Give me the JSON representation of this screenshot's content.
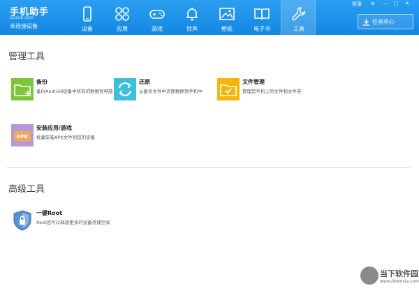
{
  "header": {
    "logo_title": "手机助手",
    "logo_url": "5Dsub.com",
    "connection_status": "未连接设备",
    "top_links": [
      "登录",
      "≡",
      "—",
      "▢",
      "✕"
    ],
    "task_center_label": "任务中心"
  },
  "nav": [
    {
      "label": "设备",
      "icon": "phone-icon"
    },
    {
      "label": "应用",
      "icon": "apps-icon"
    },
    {
      "label": "游戏",
      "icon": "gamepad-icon"
    },
    {
      "label": "铃声",
      "icon": "bell-icon"
    },
    {
      "label": "壁纸",
      "icon": "image-icon"
    },
    {
      "label": "电子书",
      "icon": "book-icon"
    },
    {
      "label": "工具",
      "icon": "wrench-icon",
      "active": true
    }
  ],
  "sections": {
    "management_title": "管理工具",
    "advanced_title": "高级工具"
  },
  "tools": {
    "backup": {
      "name": "备份",
      "desc": "备份Android设备中所有的数据到电脑",
      "color": "#7cc63b"
    },
    "restore": {
      "name": "还原",
      "desc": "从备份文件中还原数据到手机中",
      "color": "#3ec0dd"
    },
    "file_manager": {
      "name": "文件管理",
      "desc": "管理您手机上的文件和文件夹",
      "color": "#f5b50a"
    },
    "install": {
      "name": "安装应用/游戏",
      "desc": "批量安装APK文件到您的设备",
      "color": "#b59ad6"
    },
    "root": {
      "name": "一键Root",
      "desc": "Root后可以释放更多的设备存储空间",
      "color": "#5a8fd0"
    }
  },
  "watermark": {
    "text": "当下软件园",
    "url": "www.downxia.com"
  },
  "colors": {
    "header_blue": "#1a8fe6"
  }
}
